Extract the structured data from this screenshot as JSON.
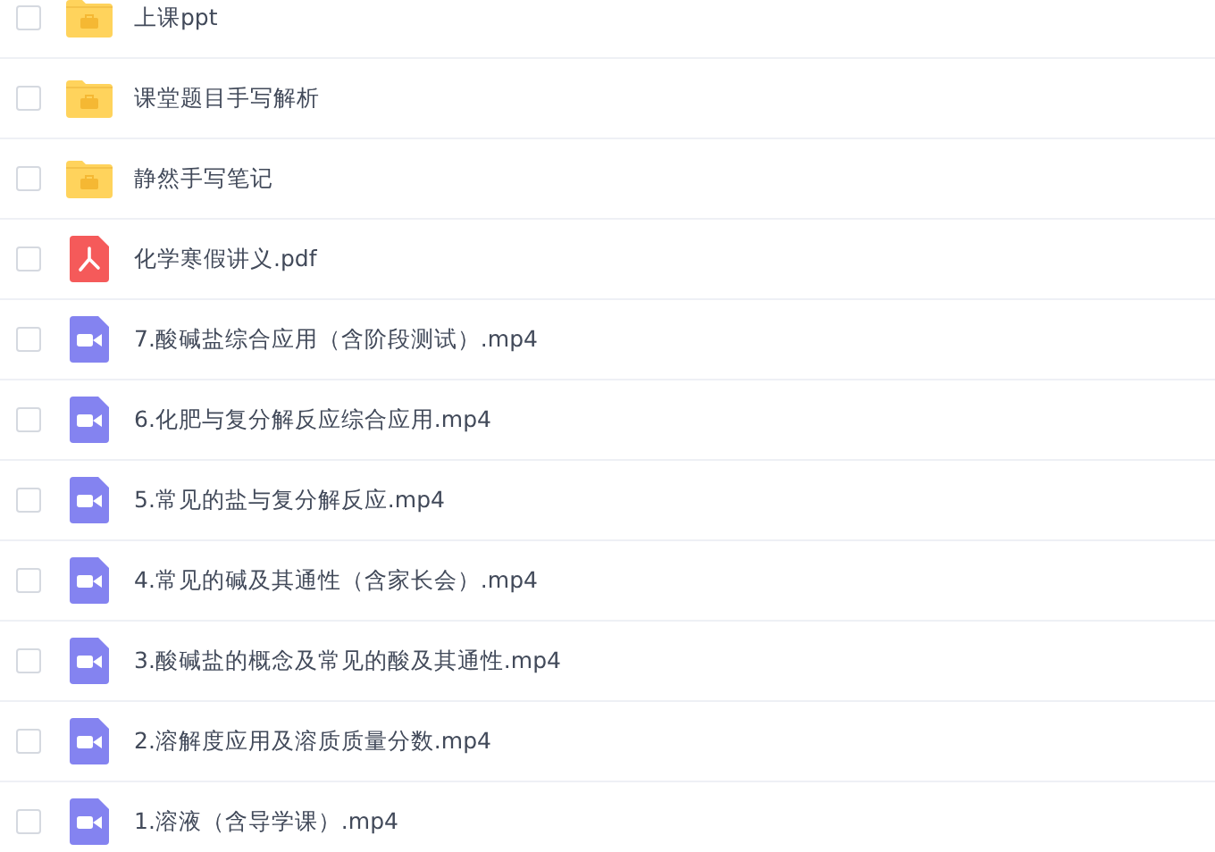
{
  "files": [
    {
      "kind": "folder",
      "name": "上课ppt",
      "checked": false
    },
    {
      "kind": "folder",
      "name": "课堂题目手写解析",
      "checked": false
    },
    {
      "kind": "folder",
      "name": "静然手写笔记",
      "checked": false
    },
    {
      "kind": "pdf",
      "name": "化学寒假讲义.pdf",
      "checked": false
    },
    {
      "kind": "video",
      "name": "7.酸碱盐综合应用（含阶段测试）.mp4",
      "checked": false
    },
    {
      "kind": "video",
      "name": "6.化肥与复分解反应综合应用.mp4",
      "checked": false
    },
    {
      "kind": "video",
      "name": "5.常见的盐与复分解反应.mp4",
      "checked": false
    },
    {
      "kind": "video",
      "name": "4.常见的碱及其通性（含家长会）.mp4",
      "checked": false
    },
    {
      "kind": "video",
      "name": "3.酸碱盐的概念及常见的酸及其通性.mp4",
      "checked": false
    },
    {
      "kind": "video",
      "name": "2.溶解度应用及溶质质量分数.mp4",
      "checked": false
    },
    {
      "kind": "video",
      "name": "1.溶液（含导学课）.mp4",
      "checked": false
    }
  ]
}
